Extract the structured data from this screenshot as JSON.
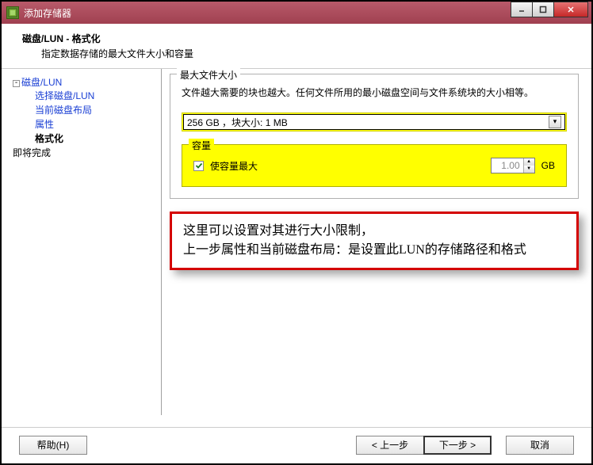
{
  "window": {
    "title": "添加存储器"
  },
  "header": {
    "title": "磁盘/LUN - 格式化",
    "subtitle": "指定数据存储的最大文件大小和容量"
  },
  "sidebar": {
    "root": "磁盘/LUN",
    "items": [
      {
        "label": "选择磁盘/LUN"
      },
      {
        "label": "当前磁盘布局"
      },
      {
        "label": "属性"
      },
      {
        "label": "格式化"
      }
    ],
    "last": "即将完成"
  },
  "content": {
    "fs_legend": "最大文件大小",
    "fs_desc": "文件越大需要的块也越大。任何文件所用的最小磁盘空间与文件系统块的大小相等。",
    "select_value": "256 GB ，块大小: 1 MB",
    "cap_legend": "容量",
    "cap_checkbox_label": "使容量最大",
    "cap_value": "1.00",
    "cap_unit": "GB"
  },
  "note": {
    "line1": "这里可以设置对其进行大小限制，",
    "line2": "上一步属性和当前磁盘布局：是设置此LUN的存储路径和格式"
  },
  "footer": {
    "help": "帮助(H)",
    "back": "< 上一步",
    "next": "下一步 >",
    "cancel": "取消"
  }
}
